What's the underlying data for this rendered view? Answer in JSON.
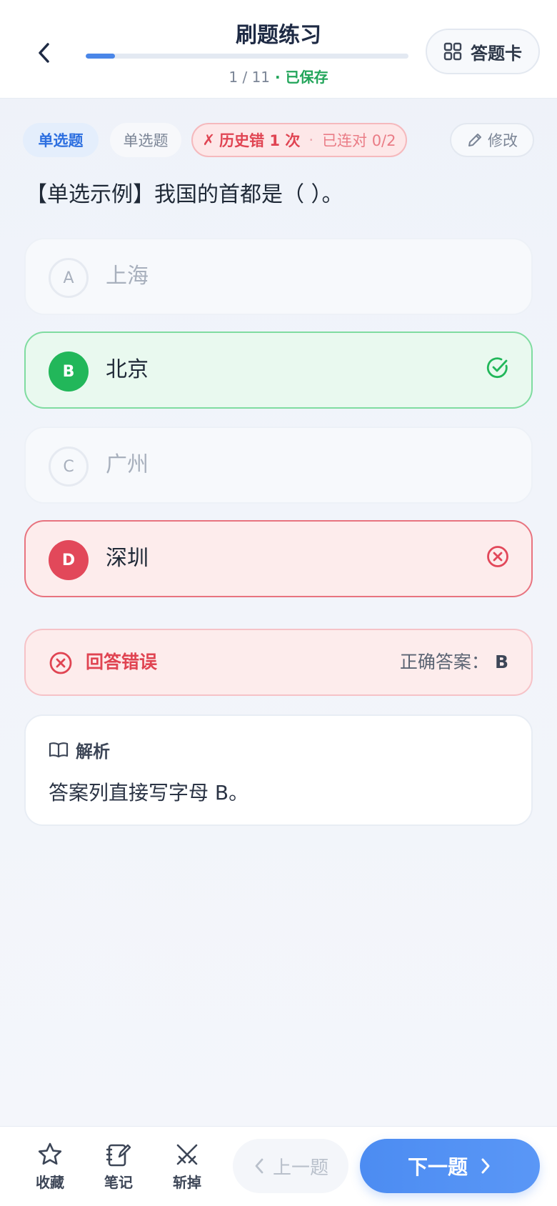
{
  "header": {
    "title": "刷题练习",
    "progress_text": "1 / 11",
    "separator": " · ",
    "saved": "已保存",
    "progress_fraction": 0.0909,
    "card_label": "答题卡"
  },
  "tags": {
    "type": "单选题",
    "type_secondary": "单选题",
    "history_mark": "✗",
    "history": "历史错 1 次",
    "dot": "·",
    "streak": "已连对 0/2",
    "edit": "修改"
  },
  "question": "【单选示例】我国的首都是（ ）。",
  "options": [
    {
      "letter": "A",
      "text": "上海",
      "state": "dim"
    },
    {
      "letter": "B",
      "text": "北京",
      "state": "correct"
    },
    {
      "letter": "C",
      "text": "广州",
      "state": "dim"
    },
    {
      "letter": "D",
      "text": "深圳",
      "state": "wrong"
    }
  ],
  "result": {
    "label": "回答错误",
    "answer_label": "正确答案：",
    "answer_value": "B"
  },
  "analysis": {
    "title": "解析",
    "body": "答案列直接写字母 B。"
  },
  "bottom": {
    "favorite": "收藏",
    "note": "笔记",
    "cut": "斩掉",
    "prev": "上一题",
    "next": "下一题"
  },
  "colors": {
    "accent": "#4a86e8",
    "correct": "#22b75a",
    "wrong": "#e2485a"
  }
}
